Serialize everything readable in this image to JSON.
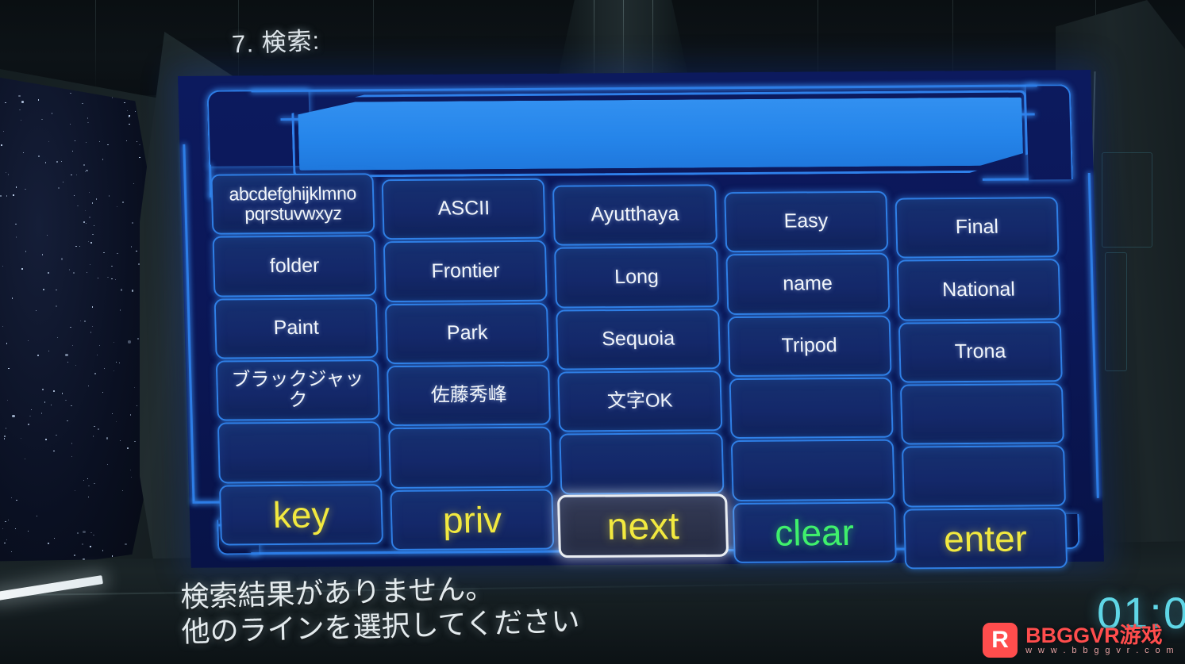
{
  "scene": {
    "step_title": "7. 検索:",
    "status_line_1": "検索結果がありません。",
    "status_line_2": "他のラインを選択してください",
    "timer": "01:0",
    "colors": {
      "panel_bg": "#0c1a5e",
      "key_fill": "#16306f",
      "key_border": "#2f7fe6",
      "input_fill": "#2585ea",
      "accent_yellow": "#f2e93f",
      "accent_green": "#3ff06c",
      "selected_border": "#e9edf2",
      "selected_fill": "#2b3149",
      "timer_color": "#5fd6e6"
    }
  },
  "search": {
    "value": "",
    "placeholder": ""
  },
  "keyboard": {
    "columns": 5,
    "rows": 6,
    "keys": [
      {
        "label": "abcdefghijklmno pqrstuvwxyz",
        "name": "key-alphabet",
        "style": "alpha",
        "row": 0,
        "col": 0
      },
      {
        "label": "ASCII",
        "name": "key-ascii",
        "style": "word",
        "row": 0,
        "col": 1
      },
      {
        "label": "Ayutthaya",
        "name": "key-ayutthaya",
        "style": "word",
        "row": 0,
        "col": 2
      },
      {
        "label": "Easy",
        "name": "key-easy",
        "style": "word",
        "row": 0,
        "col": 3
      },
      {
        "label": "Final",
        "name": "key-final",
        "style": "word",
        "row": 0,
        "col": 4
      },
      {
        "label": "folder",
        "name": "key-folder",
        "style": "word",
        "row": 1,
        "col": 0
      },
      {
        "label": "Frontier",
        "name": "key-frontier",
        "style": "word",
        "row": 1,
        "col": 1
      },
      {
        "label": "Long",
        "name": "key-long",
        "style": "word",
        "row": 1,
        "col": 2
      },
      {
        "label": "name",
        "name": "key-name",
        "style": "word",
        "row": 1,
        "col": 3
      },
      {
        "label": "National",
        "name": "key-national",
        "style": "word",
        "row": 1,
        "col": 4
      },
      {
        "label": "Paint",
        "name": "key-paint",
        "style": "word",
        "row": 2,
        "col": 0
      },
      {
        "label": "Park",
        "name": "key-park",
        "style": "word",
        "row": 2,
        "col": 1
      },
      {
        "label": "Sequoia",
        "name": "key-sequoia",
        "style": "word",
        "row": 2,
        "col": 2
      },
      {
        "label": "Tripod",
        "name": "key-tripod",
        "style": "word",
        "row": 2,
        "col": 3
      },
      {
        "label": "Trona",
        "name": "key-trona",
        "style": "word",
        "row": 2,
        "col": 4
      },
      {
        "label": "ブラックジャック",
        "name": "key-blackjack-jp",
        "style": "jp",
        "row": 3,
        "col": 0
      },
      {
        "label": "佐藤秀峰",
        "name": "key-sato-shuho-jp",
        "style": "jp",
        "row": 3,
        "col": 1
      },
      {
        "label": "文字OK",
        "name": "key-moji-ok-jp",
        "style": "jp",
        "row": 3,
        "col": 2
      },
      {
        "label": "",
        "name": "key-empty-1",
        "style": "empty",
        "row": 3,
        "col": 3
      },
      {
        "label": "",
        "name": "key-empty-2",
        "style": "empty",
        "row": 3,
        "col": 4
      },
      {
        "label": "",
        "name": "key-empty-3",
        "style": "empty",
        "row": 4,
        "col": 0
      },
      {
        "label": "",
        "name": "key-empty-4",
        "style": "empty",
        "row": 4,
        "col": 1
      },
      {
        "label": "",
        "name": "key-empty-5",
        "style": "empty",
        "row": 4,
        "col": 2
      },
      {
        "label": "",
        "name": "key-empty-6",
        "style": "empty",
        "row": 4,
        "col": 3
      },
      {
        "label": "",
        "name": "key-empty-7",
        "style": "empty",
        "row": 4,
        "col": 4
      },
      {
        "label": "key",
        "name": "key-key-command",
        "style": "cmd-yellow",
        "row": 5,
        "col": 0
      },
      {
        "label": "priv",
        "name": "key-priv-command",
        "style": "cmd-yellow",
        "row": 5,
        "col": 1
      },
      {
        "label": "next",
        "name": "key-next-command",
        "style": "cmd-yellow",
        "row": 5,
        "col": 2,
        "selected": true
      },
      {
        "label": "clear",
        "name": "key-clear-command",
        "style": "cmd-green",
        "row": 5,
        "col": 3
      },
      {
        "label": "enter",
        "name": "key-enter-command",
        "style": "cmd-yellow",
        "row": 5,
        "col": 4
      }
    ]
  },
  "watermark": {
    "logo_glyph": "R",
    "name": "BBGGVR游戏",
    "site": "w w w . b b g g v r . c o m"
  }
}
